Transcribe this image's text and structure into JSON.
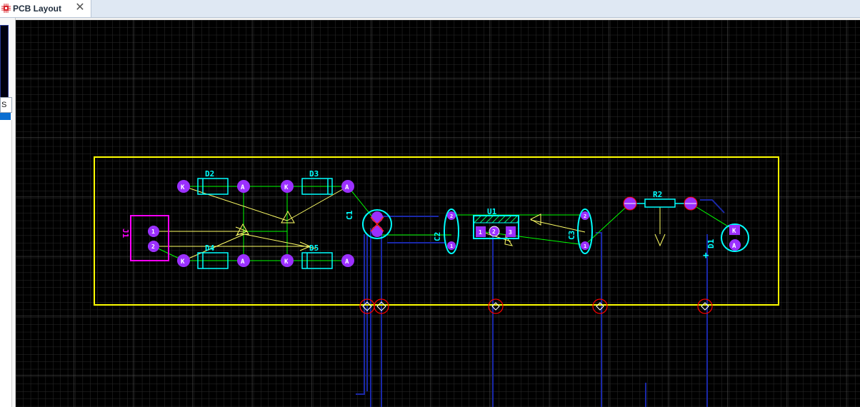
{
  "tab": {
    "label": "PCB Layout",
    "close_glyph": "✕",
    "icon": "pcb-chip-icon"
  },
  "side_panel": {
    "tab_label": "S"
  },
  "colors": {
    "background": "#000000",
    "grid": "#3c3c3c",
    "board_outline": "#ffff00",
    "silkscreen": "#00ffff",
    "ratsnest": "#00ff00",
    "pad": "#9b30ff",
    "track_bottom": "#1a28a8",
    "connector_silk": "#ff00ff",
    "drill": "#ff0000",
    "arrow": "#ffff66"
  },
  "components": {
    "d2": {
      "ref": "D2",
      "pad_k": "K",
      "pad_a": "A"
    },
    "d3": {
      "ref": "D3",
      "pad_k": "K",
      "pad_a": "A"
    },
    "d4": {
      "ref": "D4",
      "pad_k": "K",
      "pad_a": "A"
    },
    "d5": {
      "ref": "D5",
      "pad_k": "K",
      "pad_a": "A"
    },
    "j1": {
      "ref": "J1",
      "pad_1": "1",
      "pad_2": "2"
    },
    "c1": {
      "ref": "C1"
    },
    "c2": {
      "ref": "C2",
      "pad_1": "1",
      "pad_2": "2"
    },
    "c3": {
      "ref": "C3",
      "pad_1": "1",
      "pad_2": "2"
    },
    "u1": {
      "ref": "U1",
      "pad_1": "1",
      "pad_2": "2",
      "pad_3": "3"
    },
    "r2": {
      "ref": "R2"
    },
    "d1": {
      "ref": "D1",
      "pad_k": "K",
      "pad_a": "A",
      "polarity": "+"
    }
  }
}
